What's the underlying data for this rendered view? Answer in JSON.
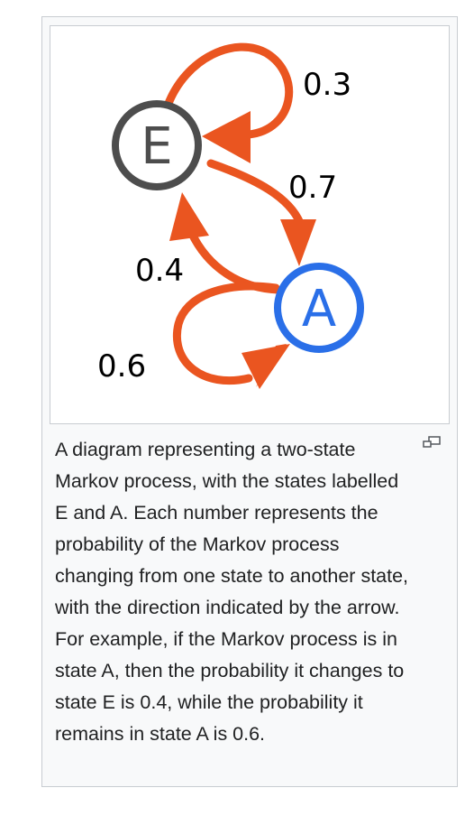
{
  "figure": {
    "diagram": {
      "states": [
        {
          "id": "E",
          "label": "E",
          "color": "#4d4d4d"
        },
        {
          "id": "A",
          "label": "A",
          "color": "#2a6fe8"
        }
      ],
      "transitions": [
        {
          "from": "E",
          "to": "E",
          "label": "0.3"
        },
        {
          "from": "E",
          "to": "A",
          "label": "0.7"
        },
        {
          "from": "A",
          "to": "E",
          "label": "0.4"
        },
        {
          "from": "A",
          "to": "A",
          "label": "0.6"
        }
      ],
      "arrow_color": "#ea5520"
    },
    "caption": "A diagram representing a two-state Markov process, with the states labelled E and A. Each number represents the probability of the Markov process changing from one state to another state, with the direction indicated by the arrow. For example, if the Markov process is in state A, then the probability it changes to state E is 0.4, while the probability it remains in state A is 0.6.",
    "enlarge_icon": "magnify-clip-icon"
  }
}
